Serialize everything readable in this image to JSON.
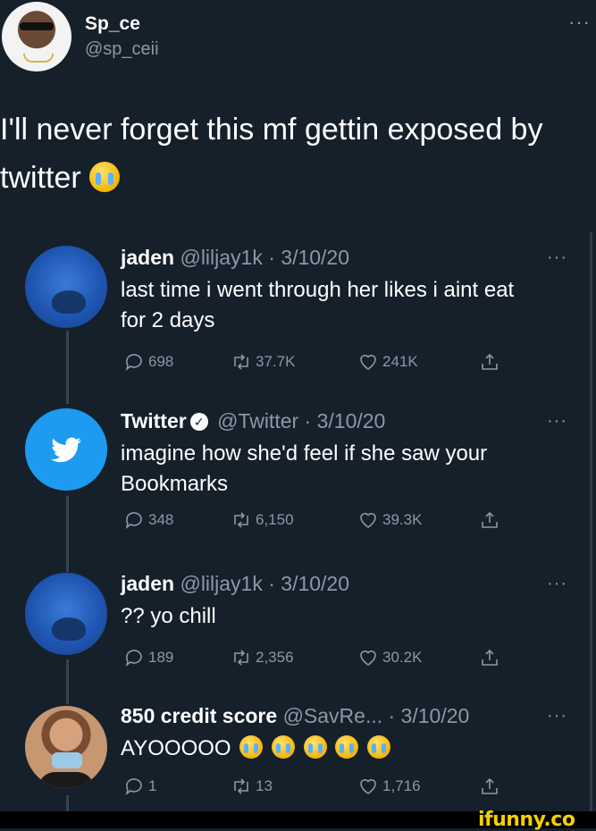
{
  "header": {
    "name": "Sp_ce",
    "handle": "@sp_ceii",
    "more": "···"
  },
  "main_tweet": {
    "line1": "I'll never forget this mf gettin exposed by",
    "line2": "twitter"
  },
  "tweets": [
    {
      "name": "jaden",
      "meta": "@liljay1k · 3/10/20",
      "line1": "last time i went through her likes i aint eat",
      "line2": "for 2 days",
      "replies": "698",
      "retweets": "37.7K",
      "likes": "241K"
    },
    {
      "name": "Twitter",
      "verified": "✓",
      "meta": "@Twitter · 3/10/20",
      "line1": "imagine how she'd feel if she saw your",
      "line2": "Bookmarks",
      "replies": "348",
      "retweets": "6,150",
      "likes": "39.3K"
    },
    {
      "name": "jaden",
      "meta": "@liljay1k · 3/10/20",
      "line1": "?? yo chill",
      "replies": "189",
      "retweets": "2,356",
      "likes": "30.2K"
    },
    {
      "name": "850 credit score",
      "meta": "@SavRe... · 3/10/20",
      "line1": "AYOOOOO",
      "replies": "1",
      "retweets": "13",
      "likes": "1,716"
    }
  ],
  "icons": {
    "reply": "reply-icon",
    "retweet": "retweet-icon",
    "like": "heart-icon",
    "share": "share-icon"
  },
  "footer": {
    "watermark": "ifunny.co"
  },
  "colors": {
    "background": "#15202b",
    "text": "#ffffff",
    "muted": "#8b98a5",
    "twitter_blue": "#1d9bf0",
    "ifunny_yellow": "#f5d000"
  }
}
